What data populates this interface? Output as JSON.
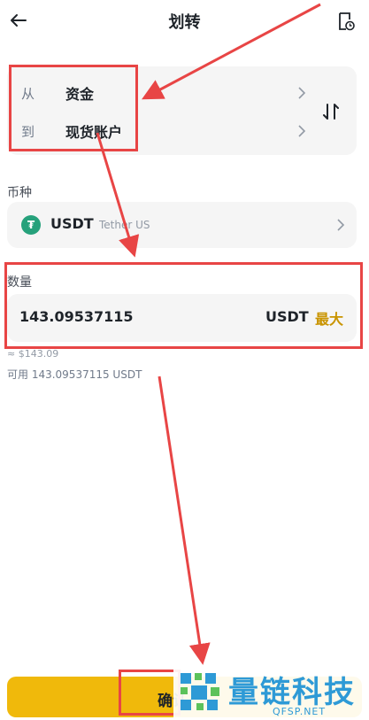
{
  "header": {
    "title": "划转",
    "back_icon": "arrow-left-icon",
    "history_icon": "transfer-history-icon"
  },
  "transfer": {
    "from_label": "从",
    "from_value": "资金",
    "to_label": "到",
    "to_value": "现货账户",
    "swap_icon": "swap-arrows-icon"
  },
  "coin": {
    "section_label": "币种",
    "symbol": "USDT",
    "name": "Tether US",
    "icon_glyph": "₮",
    "icon_color": "#26a17b"
  },
  "amount": {
    "section_label": "数量",
    "value": "143.09537115",
    "unit": "USDT",
    "max_label": "最大",
    "approx": "≈ $143.09",
    "available": "可用 143.09537115 USDT"
  },
  "footer": {
    "confirm_label": "确认"
  },
  "watermark": {
    "text": "量链科技",
    "sub": "QFSP.NET"
  },
  "colors": {
    "accent": "#f0b90b",
    "max_text": "#c99400",
    "annotation": "#e84545",
    "watermark": "#2e9ad6"
  }
}
